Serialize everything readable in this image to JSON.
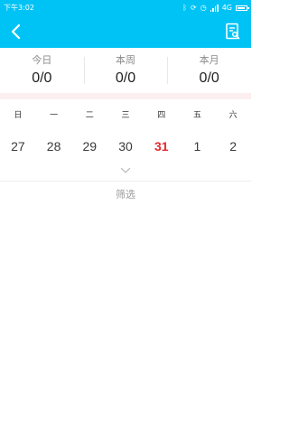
{
  "status_bar": {
    "time": "下午3:02",
    "network": "4G"
  },
  "nav": {
    "back_icon": "chevron-left-icon",
    "report_icon": "document-search-icon",
    "background": "#00c3f5"
  },
  "stats": [
    {
      "label": "今日",
      "value": "0/0"
    },
    {
      "label": "本周",
      "value": "0/0"
    },
    {
      "label": "本月",
      "value": "0/0"
    }
  ],
  "calendar": {
    "weekdays": [
      "日",
      "一",
      "二",
      "三",
      "四",
      "五",
      "六"
    ],
    "dates": [
      "27",
      "28",
      "29",
      "30",
      "31",
      "1",
      "2"
    ],
    "today_index": 4,
    "today_color": "#e8272a",
    "expand_icon": "chevron-down-icon"
  },
  "filter": {
    "label": "筛选"
  }
}
